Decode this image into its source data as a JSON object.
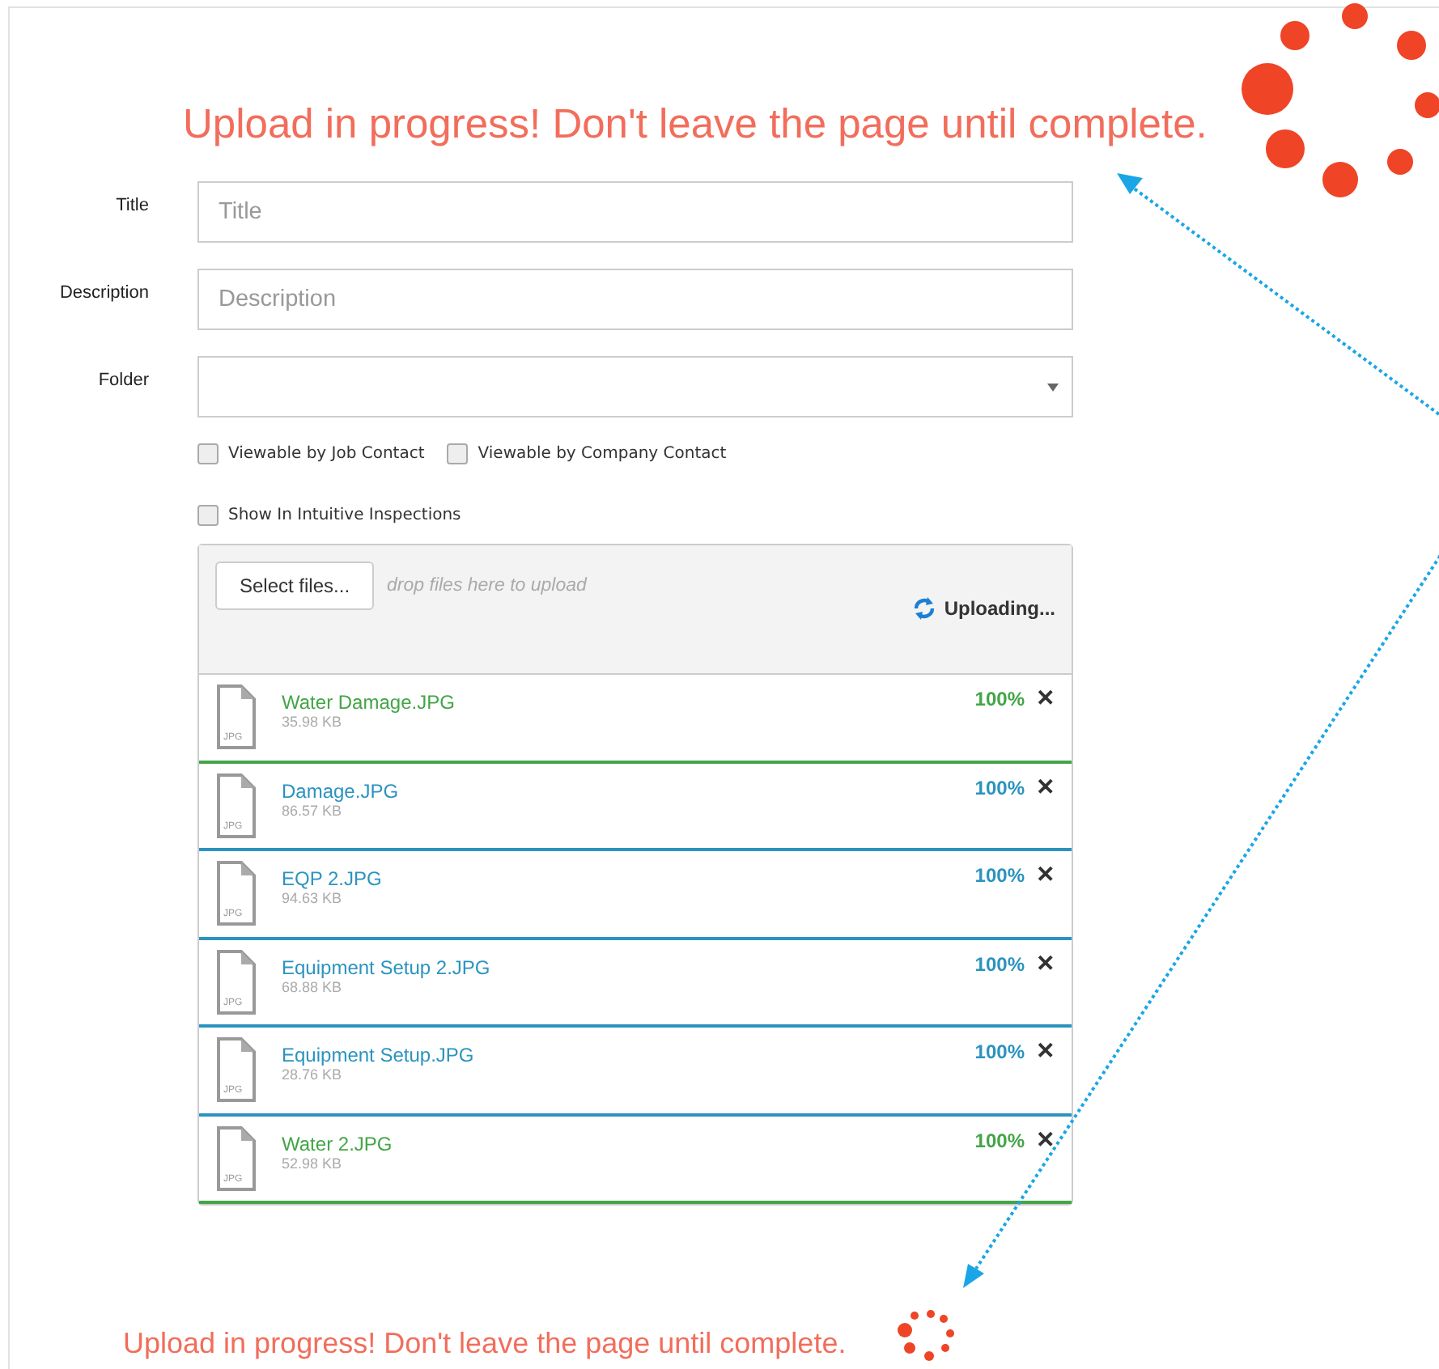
{
  "heading": "Upload in progress! Don't leave the page until complete.",
  "fields": [
    {
      "kind": "text",
      "label": "Title",
      "placeholder": "Title"
    },
    {
      "kind": "text",
      "label": "Description",
      "placeholder": "Description"
    },
    {
      "kind": "select",
      "label": "Folder"
    }
  ],
  "checkbox_rows": [
    [
      {
        "label": "Viewable by Job Contact",
        "checked": false
      },
      {
        "label": "Viewable by Company Contact",
        "checked": false
      }
    ],
    [
      {
        "label": "Show In Intuitive Inspections",
        "checked": false
      }
    ]
  ],
  "upload": {
    "select_button": "Select files...",
    "drop_hint": "drop files here to upload",
    "status": "Uploading...",
    "files": [
      {
        "name": "Water Damage.JPG",
        "size": "35.98 KB",
        "type_label": "JPG",
        "percent": "100%",
        "level": 1,
        "color": "#43a547",
        "remove": "✕"
      },
      {
        "name": "Damage.JPG",
        "size": "86.57 KB",
        "type_label": "JPG",
        "percent": "100%",
        "level": 1,
        "color": "#2b93bf",
        "remove": "✕"
      },
      {
        "name": "EQP 2.JPG",
        "size": "94.63 KB",
        "type_label": "JPG",
        "percent": "100%",
        "level": 1,
        "color": "#2b93bf",
        "remove": "✕"
      },
      {
        "name": "Equipment Setup 2.JPG",
        "size": "68.88 KB",
        "type_label": "JPG",
        "percent": "100%",
        "level": 1,
        "color": "#2b93bf",
        "remove": "✕"
      },
      {
        "name": "Equipment Setup.JPG",
        "size": "28.76 KB",
        "type_label": "JPG",
        "percent": "100%",
        "level": 1,
        "color": "#2b93bf",
        "remove": "✕"
      },
      {
        "name": "Water 2.JPG",
        "size": "52.98 KB",
        "type_label": "JPG",
        "percent": "100%",
        "level": 1,
        "color": "#43a547",
        "remove": "✕"
      }
    ]
  },
  "footer_message": "Upload in progress! Don't leave the page until complete."
}
